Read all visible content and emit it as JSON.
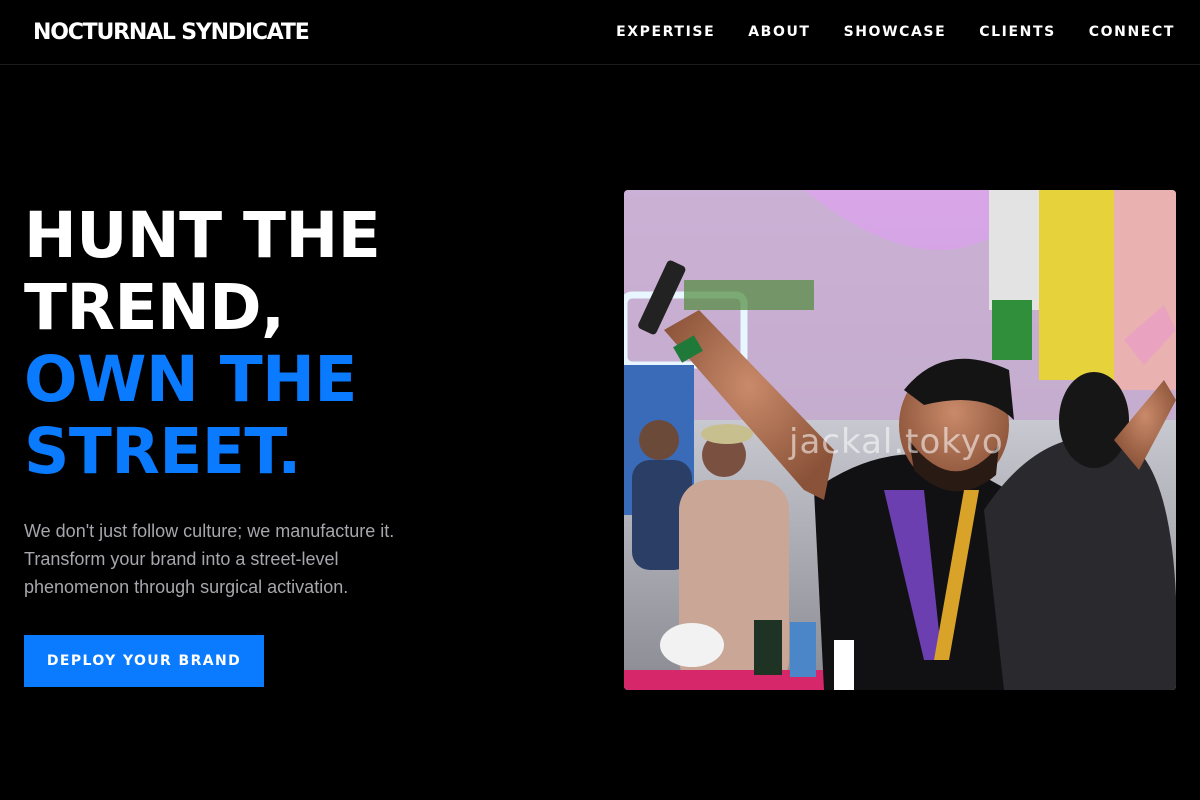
{
  "nav": {
    "brand": "NOCTURNAL SYNDICATE",
    "links": [
      "EXPERTISE",
      "ABOUT",
      "SHOWCASE",
      "CLIENTS",
      "CONNECT"
    ]
  },
  "hero": {
    "headline_white": [
      "HUNT THE",
      "TREND,"
    ],
    "headline_blue": [
      "OWN THE",
      "STREET."
    ],
    "subtext": [
      "We don't just follow culture; we manufacture it.",
      "Transform your brand into a street-level",
      "phenomenon through surgical activation."
    ],
    "cta_label": "DEPLOY YOUR BRAND",
    "image": {
      "watermark": "jackal.tokyo",
      "description_icon": "event-selfie-photo"
    }
  },
  "colors": {
    "background": "#000000",
    "accent": "#0a7aff",
    "text": "#ffffff",
    "muted": "#a6a6ad"
  }
}
